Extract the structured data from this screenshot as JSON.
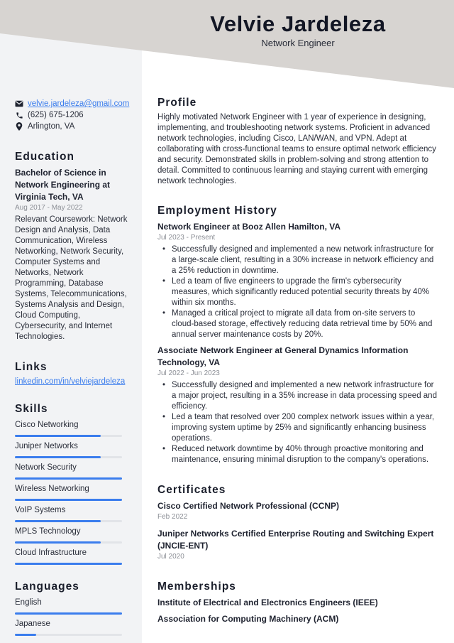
{
  "header": {
    "name": "Velvie Jardeleza",
    "job_title": "Network Engineer",
    "band_color": "#d7d4d1"
  },
  "contact": {
    "email": "velvie.jardeleza@gmail.com",
    "phone": "(625) 675-1206",
    "location": "Arlington, VA",
    "email_icon": "envelope-icon",
    "phone_icon": "phone-icon",
    "location_icon": "map-pin-icon"
  },
  "education": {
    "heading": "Education",
    "degree": "Bachelor of Science in Network Engineering at Virginia Tech, VA",
    "dates": "Aug 2017 - May 2022",
    "coursework": "Relevant Coursework: Network Design and Analysis, Data Communication, Wireless Networking, Network Security, Computer Systems and Networks, Network Programming, Database Systems, Telecommunications, Systems Analysis and Design, Cloud Computing, Cybersecurity, and Internet Technologies."
  },
  "links": {
    "heading": "Links",
    "items": [
      "linkedin.com/in/velviejardeleza"
    ]
  },
  "skills": {
    "heading": "Skills",
    "items": [
      {
        "label": "Cisco Networking",
        "level": 0.8
      },
      {
        "label": "Juniper Networks",
        "level": 0.8
      },
      {
        "label": "Network Security",
        "level": 1.0
      },
      {
        "label": "Wireless Networking",
        "level": 1.0
      },
      {
        "label": "VoIP Systems",
        "level": 0.8
      },
      {
        "label": "MPLS Technology",
        "level": 0.8
      },
      {
        "label": "Cloud Infrastructure",
        "level": 1.0
      }
    ]
  },
  "languages": {
    "heading": "Languages",
    "items": [
      {
        "label": "English",
        "level": 1.0
      },
      {
        "label": "Japanese",
        "level": 0.2
      }
    ]
  },
  "profile": {
    "heading": "Profile",
    "text": "Highly motivated Network Engineer with 1 year of experience in designing, implementing, and troubleshooting network systems. Proficient in advanced network technologies, including Cisco, LAN/WAN, and VPN. Adept at collaborating with cross-functional teams to ensure optimal network efficiency and security. Demonstrated skills in problem-solving and strong attention to detail. Committed to continuous learning and staying current with emerging network technologies."
  },
  "employment": {
    "heading": "Employment History",
    "jobs": [
      {
        "title": "Network Engineer at Booz Allen Hamilton, VA",
        "dates": "Jul 2023 - Present",
        "bullets": [
          "Successfully designed and implemented a new network infrastructure for a large-scale client, resulting in a 30% increase in network efficiency and a 25% reduction in downtime.",
          "Led a team of five engineers to upgrade the firm's cybersecurity measures, which significantly reduced potential security threats by 40% within six months.",
          "Managed a critical project to migrate all data from on-site servers to cloud-based storage, effectively reducing data retrieval time by 50% and annual server maintenance costs by 20%."
        ]
      },
      {
        "title": "Associate Network Engineer at General Dynamics Information Technology, VA",
        "dates": "Jul 2022 - Jun 2023",
        "bullets": [
          "Successfully designed and implemented a new network infrastructure for a major project, resulting in a 35% increase in data processing speed and efficiency.",
          "Led a team that resolved over 200 complex network issues within a year, improving system uptime by 25% and significantly enhancing business operations.",
          "Reduced network downtime by 40% through proactive monitoring and maintenance, ensuring minimal disruption to the company's operations."
        ]
      }
    ]
  },
  "certificates": {
    "heading": "Certificates",
    "items": [
      {
        "title": "Cisco Certified Network Professional (CCNP)",
        "date": "Feb 2022"
      },
      {
        "title": "Juniper Networks Certified Enterprise Routing and Switching Expert (JNCIE-ENT)",
        "date": "Jul 2020"
      }
    ]
  },
  "memberships": {
    "heading": "Memberships",
    "items": [
      "Institute of Electrical and Electronics Engineers (IEEE)",
      "Association for Computing Machinery (ACM)"
    ]
  },
  "colors": {
    "accent": "#3b7ded",
    "sidebar_bg": "#f2f3f5",
    "bar_track": "#e2e4e8"
  }
}
